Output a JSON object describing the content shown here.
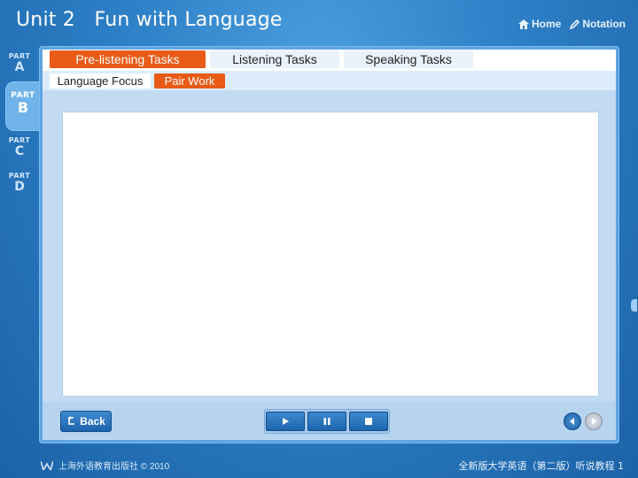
{
  "header": {
    "title": "Unit 2   Fun with Language",
    "home_label": "Home",
    "notation_label": "Notation"
  },
  "parts": [
    {
      "p": "PART",
      "l": "A"
    },
    {
      "p": "PART",
      "l": "B"
    },
    {
      "p": "PART",
      "l": "C"
    },
    {
      "p": "PART",
      "l": "D"
    }
  ],
  "tabs": [
    "Pre-listening Tasks",
    "Listening Tasks",
    "Speaking Tasks"
  ],
  "subtabs": [
    "Language Focus",
    "Pair Work"
  ],
  "controls": {
    "back_label": "Back"
  },
  "footer": {
    "left_text": "上海外语教育出版社 © 2010",
    "right_text": "全新版大学英语（第二版）听说教程 1"
  },
  "colors": {
    "accent": "#e85a16",
    "background": "#2d7fc6"
  }
}
